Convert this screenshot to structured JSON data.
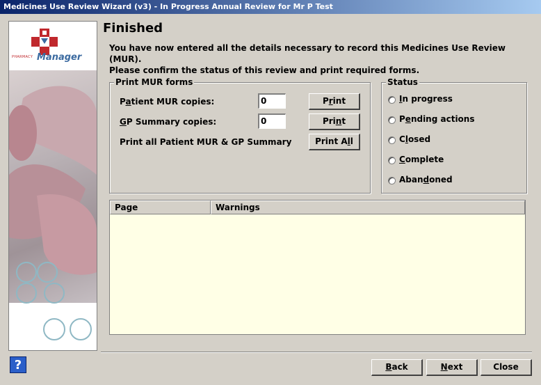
{
  "window": {
    "title": "Medicines Use Review Wizard (v3) - In Progress Annual Review for Mr P Test"
  },
  "brand": {
    "pharmacy": "PHARMACY",
    "manager": "Manager"
  },
  "page": {
    "heading": "Finished",
    "intro_line1": "You have now entered all the details necessary to record this Medicines Use Review (MUR).",
    "intro_line2": "Please confirm the status of this review and print required forms."
  },
  "print_forms": {
    "legend": "Print MUR forms",
    "patient_label_pre": "P",
    "patient_label_u": "a",
    "patient_label_post": "tient MUR copies:",
    "patient_value": "0",
    "gp_label_u": "G",
    "gp_label_post": "P Summary copies:",
    "gp_value": "0",
    "all_label": "Print all Patient MUR & GP Summary",
    "print_label_pre": "P",
    "print_label_u": "r",
    "print_label_post": "int",
    "print2_label_pre": "Pri",
    "print2_label_u": "n",
    "print2_label_post": "t",
    "print_all_label_pre": "Print A",
    "print_all_label_u": "l",
    "print_all_label_post": "l"
  },
  "status": {
    "legend": "Status",
    "options": [
      {
        "u": "I",
        "rest": "n progress"
      },
      {
        "pre": "P",
        "u": "e",
        "rest": "nding actions"
      },
      {
        "pre": "C",
        "u": "l",
        "rest": "osed"
      },
      {
        "u": "C",
        "rest": "omplete"
      },
      {
        "pre": "Aban",
        "u": "d",
        "rest": "oned"
      }
    ]
  },
  "warnings_table": {
    "columns": [
      "Page",
      "Warnings"
    ],
    "rows": []
  },
  "footer": {
    "back_u": "B",
    "back_rest": "ack",
    "next_u": "N",
    "next_rest": "ext",
    "close_label": "Close",
    "help_glyph": "?"
  },
  "colors": {
    "titlebar_start": "#0a246a",
    "list_background": "#ffffe6",
    "logo_red": "#c0282d",
    "logo_blue": "#3b6aa0"
  }
}
